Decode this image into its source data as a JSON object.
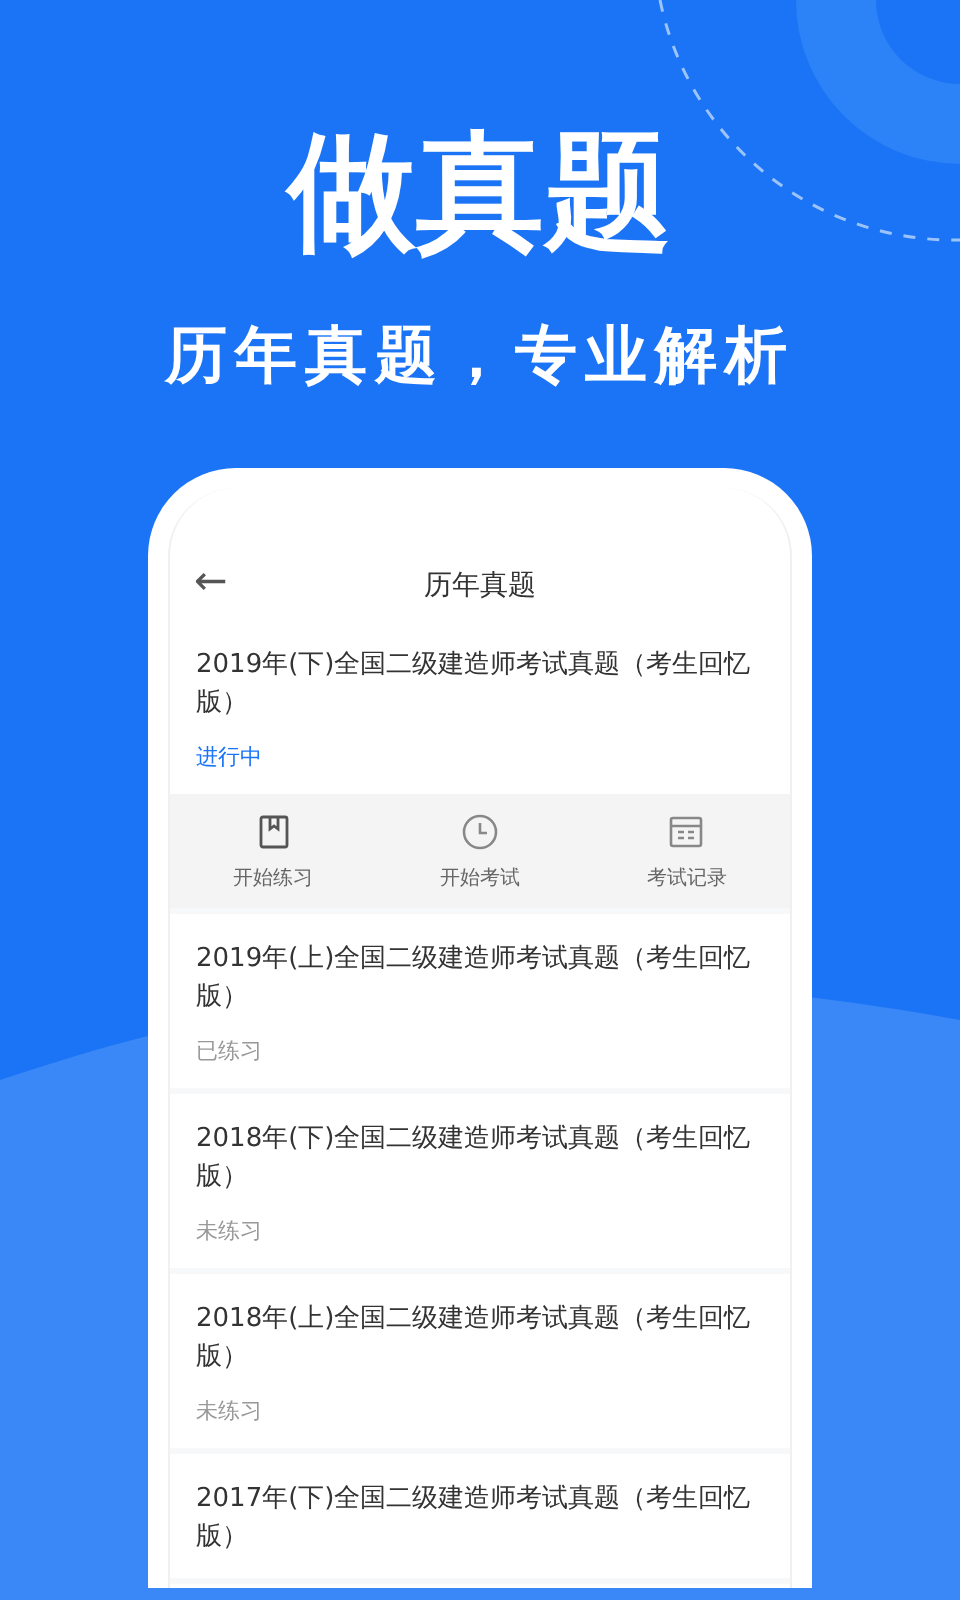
{
  "headline": "做真题",
  "subtitle": "历年真题，专业解析",
  "screen": {
    "back": "←",
    "title": "历年真题"
  },
  "papers": [
    {
      "title": "2019年(下)全国二级建造师考试真题（考生回忆版）",
      "status": "进行中",
      "active": true,
      "actions": [
        {
          "label": "开始练习"
        },
        {
          "label": "开始考试"
        },
        {
          "label": "考试记录"
        }
      ]
    },
    {
      "title": "2019年(上)全国二级建造师考试真题（考生回忆版）",
      "status": "已练习",
      "active": false
    },
    {
      "title": "2018年(下)全国二级建造师考试真题（考生回忆版）",
      "status": "未练习",
      "active": false
    },
    {
      "title": "2018年(上)全国二级建造师考试真题（考生回忆版）",
      "status": "未练习",
      "active": false
    },
    {
      "title": "2017年(下)全国二级建造师考试真题（考生回忆版）"
    }
  ]
}
